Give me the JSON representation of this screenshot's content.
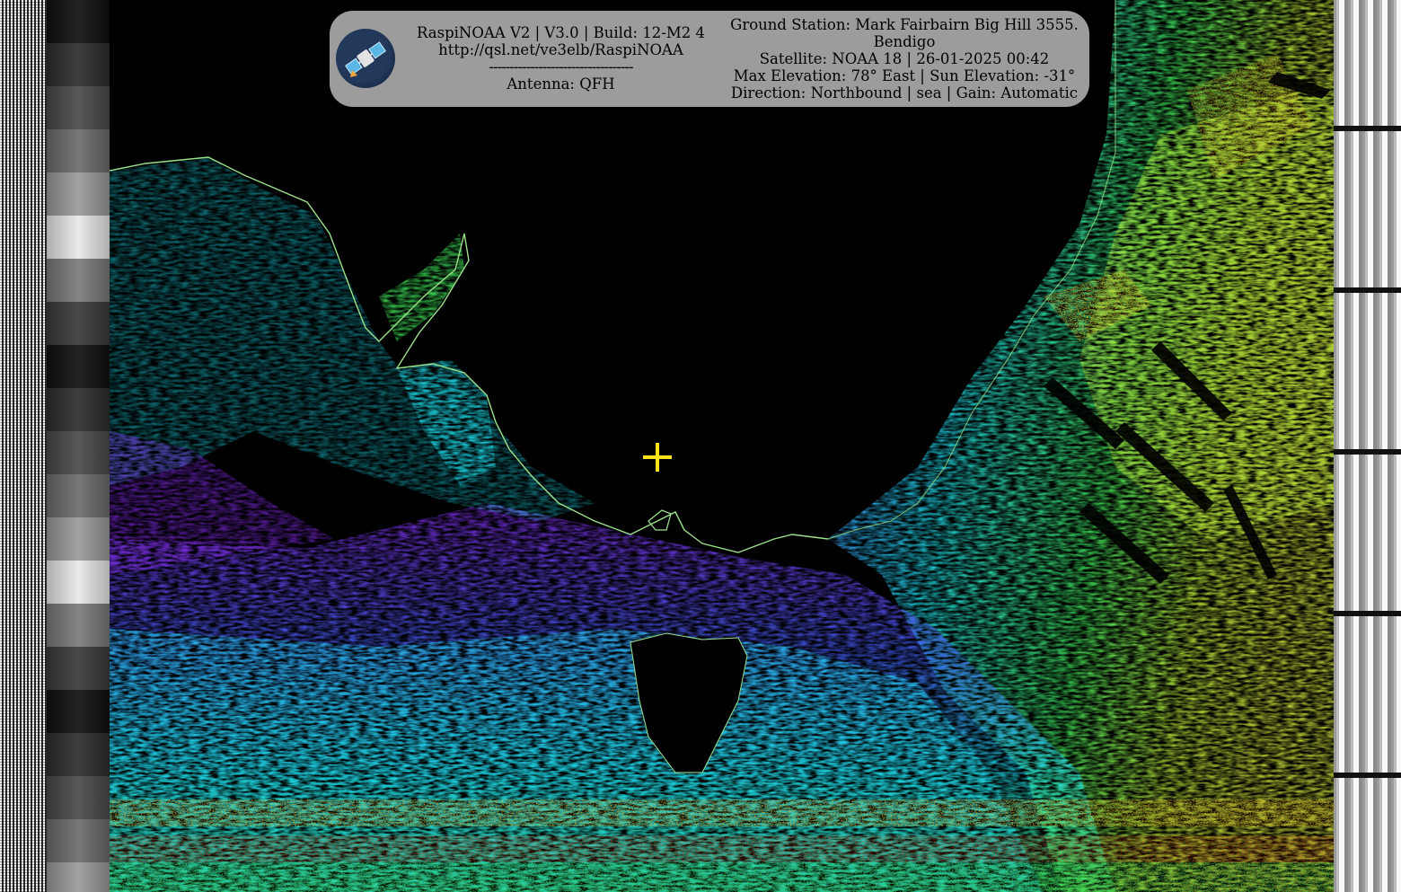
{
  "header": {
    "app_line": "RaspiNOAA V2 | V3.0 | Build: 12-M2 4",
    "url": "http://qsl.net/ve3elb/RaspiNOAA",
    "separator": "-----------------------------------",
    "antenna": "Antenna: QFH",
    "ground_station_1": "Ground Station: Mark Fairbairn Big Hill 3555.",
    "ground_station_2": "Bendigo",
    "satellite": "Satellite: NOAA 18 | 26-01-2025 00:42",
    "elevation": "Max Elevation: 78° East | Sun Elevation: -31°",
    "direction": "Direction: Northbound | sea | Gain: Automatic"
  },
  "icons": {
    "logo": "satellite-icon",
    "crosshair": "crosshair-icon"
  },
  "colors": {
    "panel_bg": "#9c9c9c",
    "crosshair": "#ffe21a",
    "coastline": "#9be08a",
    "palette": [
      "#7a28d8",
      "#3f5cf0",
      "#1fd7e6",
      "#3fe35a",
      "#b6e43a",
      "#f3c02a",
      "#e84a1c"
    ]
  }
}
